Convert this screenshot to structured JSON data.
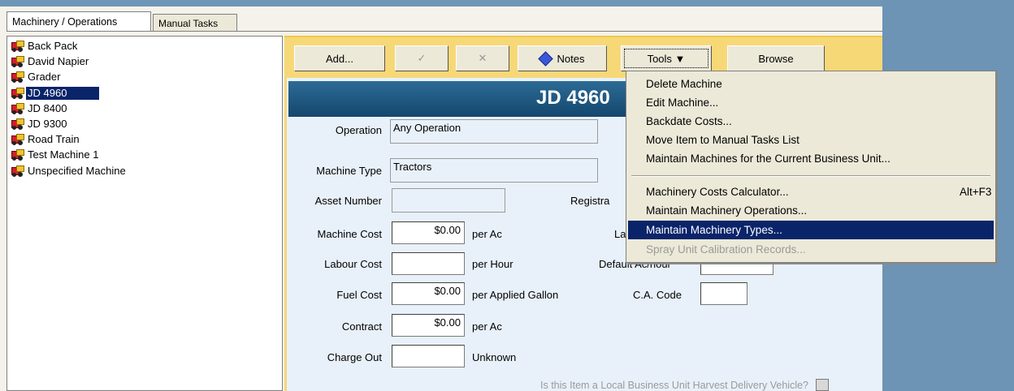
{
  "tabs": {
    "machinery": "Machinery / Operations",
    "manual": "Manual Tasks"
  },
  "tree": {
    "items": [
      "Back Pack",
      "David Napier",
      "Grader",
      "JD 4960",
      "JD 8400",
      "JD 9300",
      "Road Train",
      "Test Machine 1",
      "Unspecified Machine"
    ],
    "selected": "JD 4960"
  },
  "toolbar": {
    "add": "Add...",
    "accept": "✓",
    "cancel": "✕",
    "notes": "Notes",
    "tools": "Tools ▼",
    "browse": "Browse"
  },
  "form": {
    "title": "JD 4960",
    "operation_label": "Operation",
    "operation_value": "Any Operation",
    "machine_type_label": "Machine Type",
    "machine_type_value": "Tractors",
    "asset_number_label": "Asset Number",
    "asset_number_value": "",
    "registration_label": "Registra",
    "machine_cost_label": "Machine Cost",
    "machine_cost_value": "$0.00",
    "machine_cost_unit": "per Ac",
    "la_label": "La",
    "labour_cost_label": "Labour Cost",
    "labour_cost_value": "",
    "labour_cost_unit": "per Hour",
    "default_ac_label": "Default Ac/hour",
    "fuel_cost_label": "Fuel Cost",
    "fuel_cost_value": "$0.00",
    "fuel_cost_unit": "per Applied Gallon",
    "ca_code_label": "C.A. Code",
    "ca_code_value": "",
    "contract_label": "Contract",
    "contract_value": "$0.00",
    "contract_unit": "per Ac",
    "charge_out_label": "Charge Out",
    "charge_out_value": "",
    "charge_out_unit": "Unknown",
    "harvest_question": "Is this Item a Local Business Unit Harvest Delivery Vehicle?"
  },
  "menu": {
    "items": [
      {
        "label": "Delete Machine",
        "shortcut": "",
        "state": "normal"
      },
      {
        "label": "Edit Machine...",
        "shortcut": "",
        "state": "normal"
      },
      {
        "label": "Backdate Costs...",
        "shortcut": "",
        "state": "normal"
      },
      {
        "label": "Move Item to Manual Tasks List",
        "shortcut": "",
        "state": "normal"
      },
      {
        "label": "Maintain Machines for the Current Business Unit...",
        "shortcut": "",
        "state": "normal"
      },
      {
        "label": "Machinery Costs Calculator...",
        "shortcut": "Alt+F3",
        "state": "normal"
      },
      {
        "label": "Maintain Machinery Operations...",
        "shortcut": "",
        "state": "normal"
      },
      {
        "label": "Maintain Machinery Types...",
        "shortcut": "",
        "state": "highlighted"
      },
      {
        "label": "Spray Unit Calibration Records...",
        "shortcut": "",
        "state": "disabled"
      }
    ]
  },
  "colors": {
    "selection": "#0a246a",
    "toolbar_bg": "#f7d877",
    "title_bar": "#1d5a85",
    "content_bg": "#e8f1fa"
  }
}
